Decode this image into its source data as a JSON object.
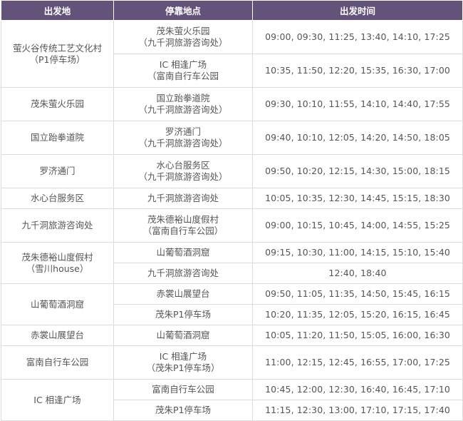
{
  "header": {
    "col1": "出发地",
    "col2": "停靠地点",
    "col3": "出发时间"
  },
  "rows": [
    {
      "origin": [
        "萤火谷传统工艺文化村",
        "（P1停车场）"
      ],
      "stop": [
        "茂朱萤火乐园",
        "（九千洞旅游咨询处）"
      ],
      "times": "09:00, 09:30, 11:25, 13:40, 14:10, 17:25"
    },
    {
      "stop": [
        "IC 相逢广场",
        "（富南自行车公园"
      ],
      "times": "10:35, 11:50, 12:20, 15:35, 16:30, 17:00"
    },
    {
      "origin": [
        "茂朱萤火乐园"
      ],
      "stop": [
        "国立跆拳道院",
        "（九千洞旅游咨询处）"
      ],
      "times": "09:30, 10:10, 11:55, 14:10, 14:40, 17:55"
    },
    {
      "origin": [
        "国立跆拳道院"
      ],
      "stop": [
        "罗济通门",
        "（九千洞旅游咨询处）"
      ],
      "times": "09:40, 10:10, 12:05, 14:20, 14:50, 18:05"
    },
    {
      "origin": [
        "罗济通门"
      ],
      "stop": [
        "水心台服务区",
        "（九千洞旅游咨询处）"
      ],
      "times": "09:50, 10:20, 12:15, 14:30, 15:00, 18:15"
    },
    {
      "origin": [
        "水心台服务区"
      ],
      "stop": [
        "九千洞旅游咨询处"
      ],
      "times": "10:05, 10:35, 12:30, 14:45, 15:15, 18:30"
    },
    {
      "origin": [
        "九千洞旅游咨询处"
      ],
      "stop": [
        "茂朱德裕山度假村",
        "（富南自行车公园）"
      ],
      "times": "09:00, 10:15, 10:45, 14:00, 14:55, 15:25"
    },
    {
      "origin": [
        "茂朱德裕山度假村",
        "（雪川house）"
      ],
      "stop": [
        "山葡萄酒洞窟"
      ],
      "times": "09:15, 10:30, 11:00, 14:15, 15:10, 15:40"
    },
    {
      "stop": [
        "九千洞旅游咨询处"
      ],
      "times": "12:40, 18:40"
    },
    {
      "origin": [
        "山葡萄酒洞窟"
      ],
      "stop": [
        "赤裳山展望台"
      ],
      "times": "09:50, 11:05, 11:35, 14:50, 15:45, 16:15"
    },
    {
      "stop": [
        "茂朱P1停车场"
      ],
      "times": "10:20, 11:35, 12:05, 15:20, 16:15, 16:45"
    },
    {
      "origin": [
        "赤裳山展望台"
      ],
      "stop": [
        "山葡萄酒洞窟"
      ],
      "times": "10:05, 11:20, 11:50, 15:05, 16:00, 16:30"
    },
    {
      "origin": [
        "富南自行车公园"
      ],
      "stop": [
        "IC 相逢广场",
        "（茂朱P1停车场）"
      ],
      "times": "11:00, 12:15, 12:45, 16:55, 17:00, 17:25"
    },
    {
      "origin": [
        "IC 相逢广场"
      ],
      "stop": [
        "富南自行车公园"
      ],
      "times": "10:45, 12:00, 12:30, 16:40, 16:45, 17:10"
    },
    {
      "stop": [
        "茂朱P1停车场"
      ],
      "times": "11:15, 12:30, 13:00, 17:10, 17:15, 17:40"
    }
  ]
}
